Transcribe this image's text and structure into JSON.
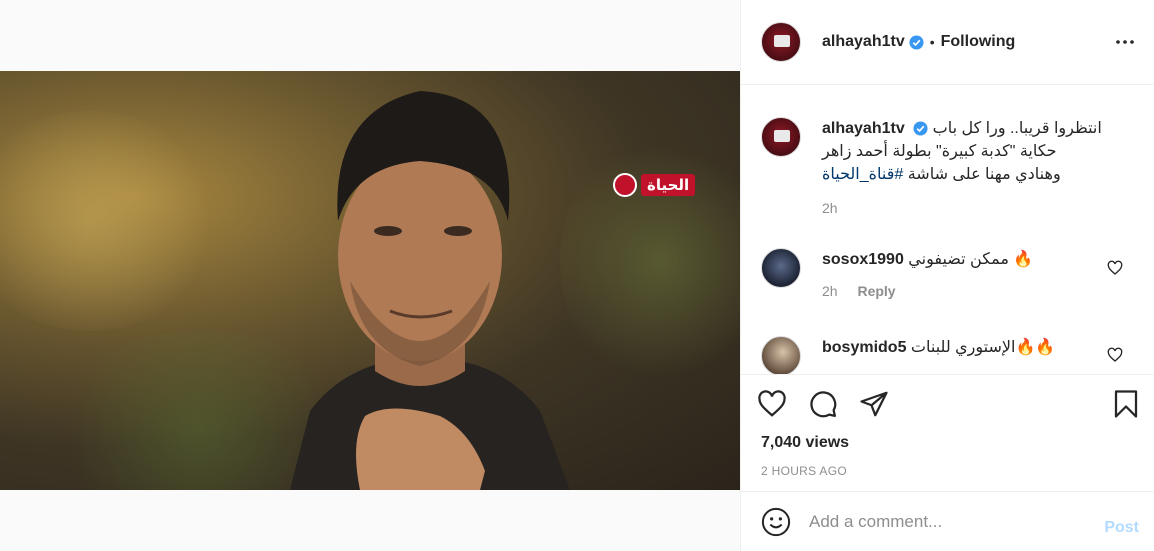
{
  "post": {
    "username": "alhayah1tv",
    "follow_status": "Following",
    "separator": "•",
    "caption_lines": [
      "انتظروا قريبا.. ورا كل باب",
      "حكاية \"كدبة كبيرة\" بطولة أحمد زاهر",
      "وهنادي مهنا على شاشة"
    ],
    "hashtag": "#قناة_الحياة",
    "caption_time": "2h"
  },
  "video": {
    "channel_logo_text": "الحياة",
    "mute_icon": "muted-speaker-icon"
  },
  "comments": [
    {
      "username": "sosox1990",
      "text": "ممكن تضيفوني 🔥",
      "time": "2h",
      "reply_label": "Reply"
    },
    {
      "username": "bosymido5",
      "text": "الإستوري للبنات🔥🔥"
    }
  ],
  "actions": {
    "views": "7,040 views",
    "time_ago": "2 HOURS AGO",
    "icons": [
      "heart-icon",
      "comment-icon",
      "share-icon",
      "bookmark-icon"
    ]
  },
  "add_comment": {
    "placeholder": "Add a comment...",
    "post_label": "Post"
  },
  "colors": {
    "verified_blue": "#3897f0",
    "post_disabled": "#b3dbff",
    "brand_red": "#c0122a"
  }
}
